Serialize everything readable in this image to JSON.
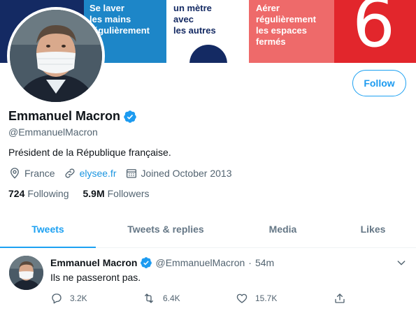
{
  "banner": {
    "panel_1_text": "Se laver\nles mains\nrégulièrement",
    "panel_2_text": "un mètre\navec\nles autres",
    "panel_3_text": "Aérer\nrégulièrement\nles espaces\nfermés",
    "panel_4_number": "6"
  },
  "profile": {
    "follow_label": "Follow",
    "name": "Emmanuel Macron",
    "handle": "@EmmanuelMacron",
    "bio": "Président de la République française.",
    "location": "France",
    "website": "elysee.fr",
    "joined": "Joined October 2013",
    "following_count": "724",
    "following_label": "Following",
    "followers_count": "5.9M",
    "followers_label": "Followers"
  },
  "tabs": [
    {
      "label": "Tweets",
      "active": true
    },
    {
      "label": "Tweets & replies",
      "active": false
    },
    {
      "label": "Media",
      "active": false
    },
    {
      "label": "Likes",
      "active": false
    }
  ],
  "tweet": {
    "name": "Emmanuel Macron",
    "handle": "@EmmanuelMacron",
    "separator": "·",
    "time": "54m",
    "text": "Ils ne passeront pas.",
    "replies": "3.2K",
    "retweets": "6.4K",
    "likes": "15.7K"
  },
  "colors": {
    "accent": "#1da1f2",
    "verified": "#1d9bf0",
    "banner_blue": "#1d86c8",
    "banner_navy": "#142a63",
    "banner_salmon": "#ee6a6a",
    "banner_red": "#e2262c"
  },
  "icons": {
    "location": "location-pin-icon",
    "link": "link-icon",
    "calendar": "calendar-icon",
    "verified": "verified-badge-icon",
    "reply": "reply-icon",
    "retweet": "retweet-icon",
    "like": "heart-icon",
    "share": "share-icon",
    "more": "chevron-down-icon"
  }
}
